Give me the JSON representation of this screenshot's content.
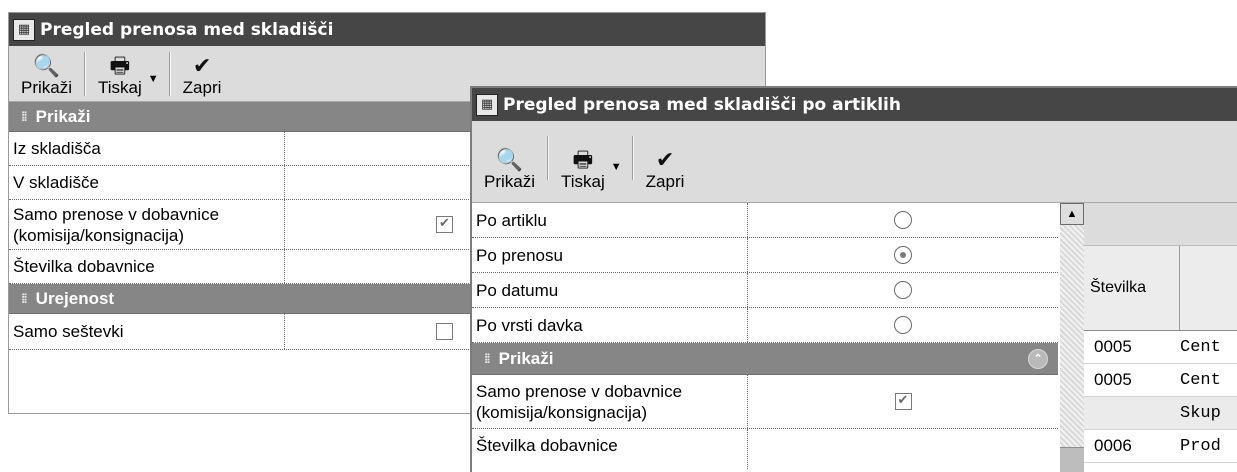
{
  "window1": {
    "title": "Pregled prenosa med skladišči",
    "toolbar": {
      "show_label": "Prikaži",
      "print_label": "Tiskaj",
      "close_label": "Zapri"
    },
    "section_show": "Prikaži",
    "rows": [
      {
        "label": "Iz skladišča"
      },
      {
        "label": "V skladišče"
      },
      {
        "label_line1": "Samo prenose v dobavnice",
        "label_line2": "(komisija/konsignacija)",
        "checked": true
      },
      {
        "label": "Številka dobavnice"
      }
    ],
    "section_order": "Urejenost",
    "totals_only_label": "Samo seštevki",
    "totals_only_checked": false
  },
  "window2": {
    "title": "Pregled prenosa med skladišči po artiklih",
    "toolbar": {
      "show_label": "Prikaži",
      "print_label": "Tiskaj",
      "close_label": "Zapri"
    },
    "options": [
      {
        "label": "Po artiklu",
        "selected": false
      },
      {
        "label": "Po prenosu",
        "selected": true
      },
      {
        "label": "Po datumu",
        "selected": false
      },
      {
        "label": "Po vrsti davka",
        "selected": false
      }
    ],
    "section_show": "Prikaži",
    "transfers_label_line1": "Samo prenose v dobavnice",
    "transfers_label_line2": "(komisija/konsignacija)",
    "transfers_checked": true,
    "delivery_no_label": "Številka dobavnice",
    "grid": {
      "header_number": "Številka",
      "rows": [
        {
          "number": "0005",
          "text": "Cent"
        },
        {
          "number": "0005",
          "text": "Cent"
        },
        {
          "number": "",
          "text": "Skup",
          "is_total": true
        },
        {
          "number": "0006",
          "text": "Prod"
        }
      ]
    }
  },
  "icons": {
    "app": "app-window-icon",
    "show": "preview-magnifier-icon",
    "print": "printer-icon",
    "close": "checkmark-icon",
    "grip": "grip-icon",
    "collapse": "chevron-double-up-icon",
    "scroll_up": "scroll-up-arrow-icon"
  }
}
